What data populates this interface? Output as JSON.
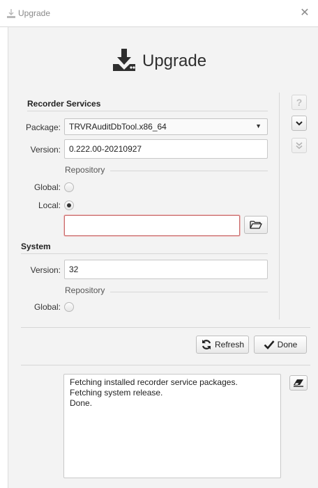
{
  "window": {
    "title": "Upgrade"
  },
  "header": {
    "title": "Upgrade"
  },
  "recorder": {
    "section_title": "Recorder Services",
    "package_label": "Package:",
    "package_value": "TRVRAuditDbTool.x86_64",
    "version_label": "Version:",
    "version_value": "0.222.00-20210927",
    "repository_label": "Repository",
    "global_label": "Global:",
    "local_label": "Local:",
    "local_path_value": "",
    "selected_repository": "Local"
  },
  "system": {
    "section_title": "System",
    "version_label": "Version:",
    "version_value": "32",
    "repository_label": "Repository",
    "global_label": "Global:"
  },
  "sidebar_buttons": {
    "help_icon": "question-icon",
    "expand_icon": "chevron-down-icon",
    "expand_all_icon": "double-chevron-down-icon"
  },
  "actions": {
    "refresh_label": "Refresh",
    "done_label": "Done"
  },
  "log": {
    "lines": [
      "Fetching installed recorder service packages.",
      "Fetching system release.",
      "Done."
    ]
  },
  "colors": {
    "background": "#f3f3f3",
    "error_border": "#c86a6a"
  }
}
